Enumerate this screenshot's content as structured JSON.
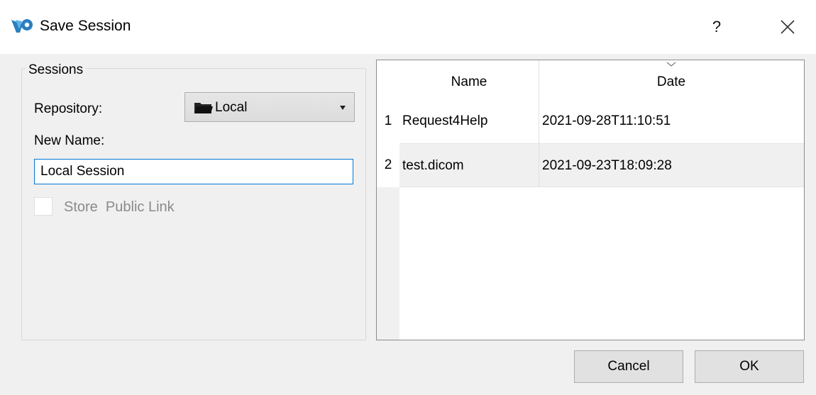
{
  "window": {
    "title": "Save Session",
    "help_label": "?",
    "app_icon": "app-logo-icon",
    "close_icon": "close-icon"
  },
  "sessions_group": {
    "title": "Sessions",
    "repository_label": "Repository:",
    "repository_value": "Local",
    "repository_icon": "folder-icon",
    "new_name_label": "New Name:",
    "new_name_value": "Local Session",
    "store_label": "Store  Public Link",
    "store_checked": false
  },
  "table": {
    "columns": [
      "Name",
      "Date"
    ],
    "sort_icon": "chevron-down-icon",
    "rows": [
      {
        "index": "1",
        "name": "Request4Help",
        "date": "2021-09-28T11:10:51"
      },
      {
        "index": "2",
        "name": "test.dicom",
        "date": "2021-09-23T18:09:28"
      }
    ]
  },
  "buttons": {
    "cancel": "Cancel",
    "ok": "OK"
  },
  "colors": {
    "accent": "#0078d7",
    "window_bg": "#f0f0f0",
    "selected_row": "#f0f0f0"
  }
}
